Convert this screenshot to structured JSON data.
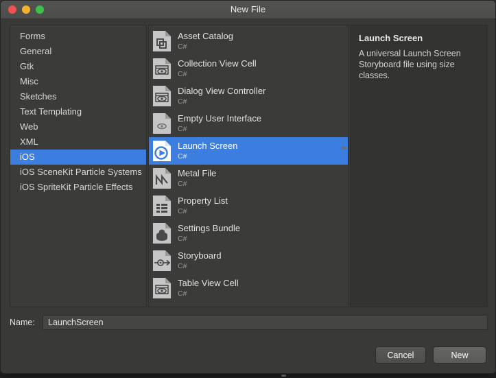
{
  "window": {
    "title": "New File",
    "traffic_lights": [
      {
        "name": "close",
        "color": "#f0534f"
      },
      {
        "name": "minimize",
        "color": "#f2b230"
      },
      {
        "name": "zoom",
        "color": "#3fc04a"
      }
    ]
  },
  "categories": {
    "items": [
      {
        "label": "Forms",
        "selected": false
      },
      {
        "label": "General",
        "selected": false
      },
      {
        "label": "Gtk",
        "selected": false
      },
      {
        "label": "Misc",
        "selected": false
      },
      {
        "label": "Sketches",
        "selected": false
      },
      {
        "label": "Text Templating",
        "selected": false
      },
      {
        "label": "Web",
        "selected": false
      },
      {
        "label": "XML",
        "selected": false
      },
      {
        "label": "iOS",
        "selected": true
      },
      {
        "label": "iOS SceneKit Particle Systems",
        "selected": false
      },
      {
        "label": "iOS SpriteKit Particle Effects",
        "selected": false
      }
    ]
  },
  "templates": {
    "items": [
      {
        "name": "Asset Catalog",
        "language": "C#",
        "icon": "asset-catalog-icon",
        "selected": false
      },
      {
        "name": "Collection View Cell",
        "language": "C#",
        "icon": "view-cell-icon",
        "selected": false
      },
      {
        "name": "Dialog View Controller",
        "language": "C#",
        "icon": "view-controller-icon",
        "selected": false
      },
      {
        "name": "Empty User Interface",
        "language": "C#",
        "icon": "empty-interface-icon",
        "selected": false
      },
      {
        "name": "Launch Screen",
        "language": "C#",
        "icon": "launch-screen-icon",
        "selected": true
      },
      {
        "name": "Metal File",
        "language": "C#",
        "icon": "metal-file-icon",
        "selected": false
      },
      {
        "name": "Property List",
        "language": "C#",
        "icon": "property-list-icon",
        "selected": false
      },
      {
        "name": "Settings Bundle",
        "language": "C#",
        "icon": "settings-bundle-icon",
        "selected": false
      },
      {
        "name": "Storyboard",
        "language": "C#",
        "icon": "storyboard-icon",
        "selected": false
      },
      {
        "name": "Table View Cell",
        "language": "C#",
        "icon": "table-view-cell-icon",
        "selected": false
      }
    ]
  },
  "detail": {
    "title": "Launch Screen",
    "description": "A universal Launch Screen Storyboard file using size classes."
  },
  "name_field": {
    "label": "Name:",
    "value": "LaunchScreen",
    "placeholder": ""
  },
  "buttons": {
    "cancel": "Cancel",
    "new": "New"
  },
  "colors": {
    "selection_blue": "#3b7ee0",
    "panel_background": "#3b3b39",
    "window_background": "#393937",
    "titlebar": "#4f4f4d",
    "text_primary": "#e2e2e2",
    "text_secondary": "#9b9b9b"
  }
}
